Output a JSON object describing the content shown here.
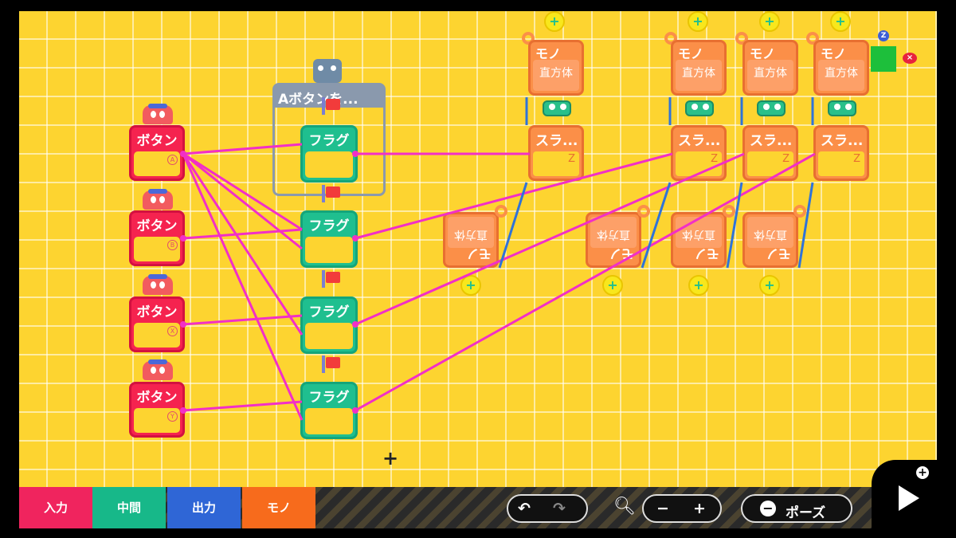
{
  "toolbar": {
    "tabs": [
      {
        "label": "入力",
        "color": "#f0245e"
      },
      {
        "label": "中間",
        "color": "#17b889"
      },
      {
        "label": "出力",
        "color": "#2f66d6"
      },
      {
        "label": "モノ",
        "color": "#f76b1c"
      }
    ],
    "undo_icon": "undo-icon",
    "redo_icon": "redo-icon",
    "zoom_icon": "magnifier-icon",
    "zoom_out": "−",
    "zoom_in": "+",
    "pause_label": "ポーズ",
    "pause_icon": "minus-circle-icon",
    "play_icon": "play-icon"
  },
  "group": {
    "label": "Aボタンを..."
  },
  "buttons": [
    {
      "label": "ボタン",
      "port": "A"
    },
    {
      "label": "ボタン",
      "port": "B"
    },
    {
      "label": "ボタン",
      "port": "X"
    },
    {
      "label": "ボタン",
      "port": "Y"
    }
  ],
  "flags": [
    {
      "label": "フラグ"
    },
    {
      "label": "フラグ"
    },
    {
      "label": "フラグ"
    },
    {
      "label": "フラグ"
    }
  ],
  "mono_top": [
    {
      "label": "モノ",
      "sub": "直方体"
    },
    {
      "label": "モノ",
      "sub": "直方体"
    },
    {
      "label": "モノ",
      "sub": "直方体"
    },
    {
      "label": "モノ",
      "sub": "直方体"
    }
  ],
  "sliders": [
    {
      "label": "スラ...",
      "axis": "Z"
    },
    {
      "label": "スラ...",
      "axis": "Z"
    },
    {
      "label": "スラ...",
      "axis": "Z"
    },
    {
      "label": "スラ...",
      "axis": "Z"
    }
  ],
  "mono_bottom": [
    {
      "label": "モノ",
      "sub": "直方体"
    },
    {
      "label": "モノ",
      "sub": "直方体"
    },
    {
      "label": "モノ",
      "sub": "直方体"
    },
    {
      "label": "モノ",
      "sub": "直方体"
    }
  ],
  "markers": {
    "z_label": "Z",
    "x_label": "×"
  },
  "colors": {
    "wire_pink": "#f22fc7",
    "wire_blue": "#2f73d9",
    "canvas": "#fdd430"
  }
}
